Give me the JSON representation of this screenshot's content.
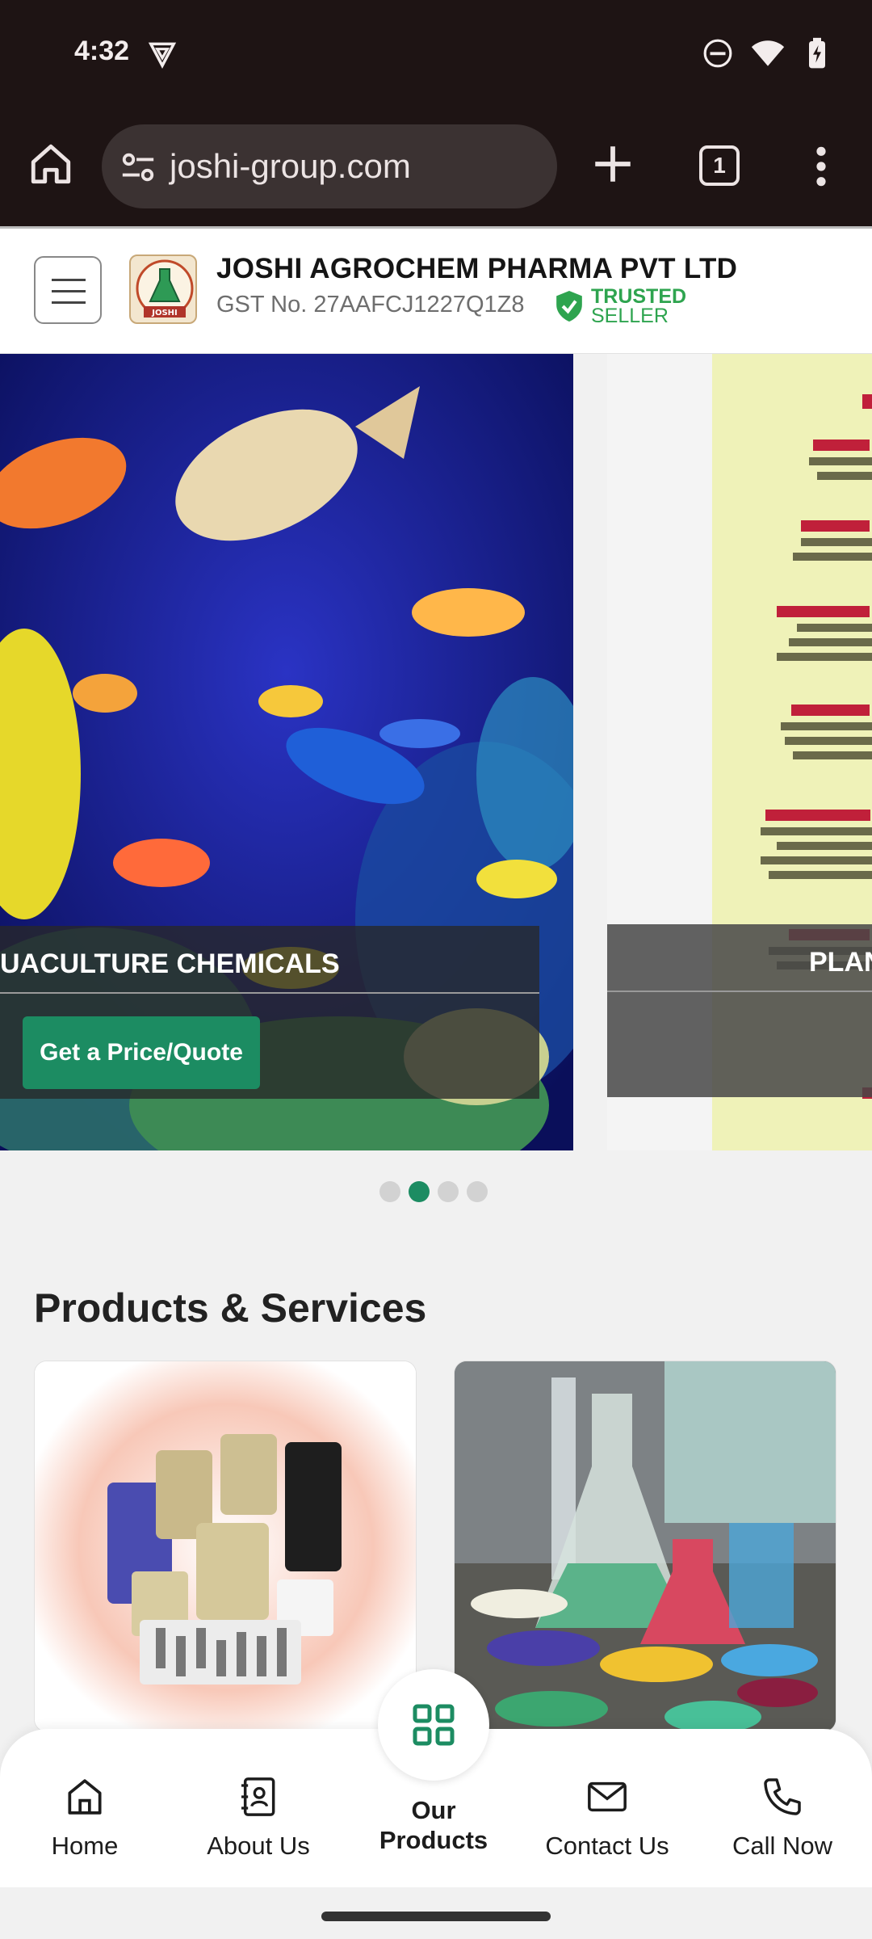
{
  "status_bar": {
    "time": "4:32"
  },
  "browser": {
    "url": "joshi-group.com",
    "tab_count": "1"
  },
  "header": {
    "company_name": "JOSHI AGROCHEM PHARMA PVT LTD",
    "gst": "GST No. 27AAFCJ1227Q1Z8",
    "trusted_line1": "TRUSTED",
    "trusted_line2": "SELLER",
    "logo_text": "JOSHI"
  },
  "carousel": {
    "slide1_caption": "UACULTURE CHEMICALS",
    "quote_button": "Get a Price/Quote",
    "slide2_caption": "PLAN",
    "slide_count": 4,
    "active_slide": 2
  },
  "products": {
    "section_title": "Products & Services"
  },
  "bottom_nav": {
    "home": "Home",
    "about": "About Us",
    "products_line1": "Our",
    "products_line2": "Products",
    "contact": "Contact Us",
    "call": "Call Now"
  },
  "colors": {
    "accent": "#1c8c62",
    "trusted": "#2ea44f",
    "browser_bg": "#1e1414"
  }
}
